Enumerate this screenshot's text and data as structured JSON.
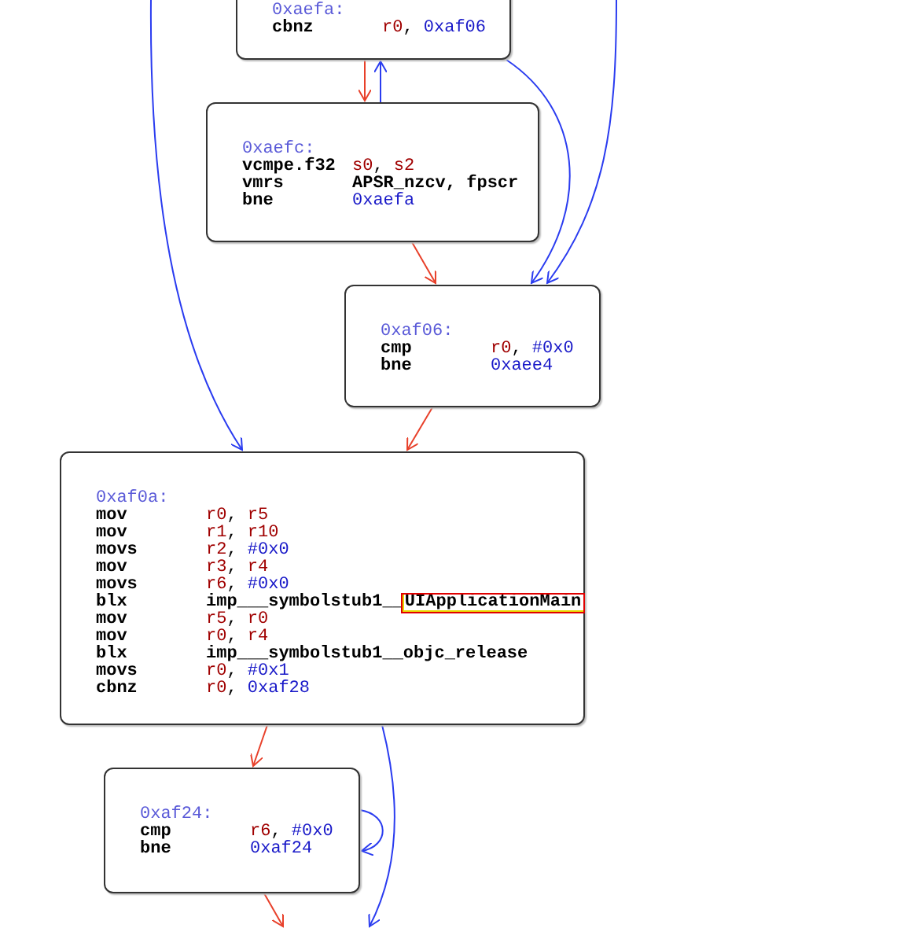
{
  "nodes": [
    {
      "label": "0xaefa:",
      "lines": [
        {
          "mnemonic": "cbnz",
          "operands": [
            {
              "text": "r0",
              "kind": "reg"
            },
            {
              "text": ", ",
              "kind": "sep"
            },
            {
              "text": "0xaf06",
              "kind": "addr"
            }
          ]
        }
      ]
    },
    {
      "label": "0xaefc:",
      "lines": [
        {
          "mnemonic": "vcmpe.f32",
          "operands": [
            {
              "text": "s0",
              "kind": "reg"
            },
            {
              "text": ", ",
              "kind": "sep"
            },
            {
              "text": "s2",
              "kind": "reg"
            }
          ]
        },
        {
          "mnemonic": "vmrs",
          "operands": [
            {
              "text": "APSR_nzcv, fpscr",
              "kind": "sym"
            }
          ]
        },
        {
          "mnemonic": "bne",
          "operands": [
            {
              "text": "0xaefa",
              "kind": "addr"
            }
          ]
        }
      ]
    },
    {
      "label": "0xaf06:",
      "lines": [
        {
          "mnemonic": "cmp",
          "operands": [
            {
              "text": "r0",
              "kind": "reg"
            },
            {
              "text": ", ",
              "kind": "sep"
            },
            {
              "text": "#0x0",
              "kind": "imm"
            }
          ]
        },
        {
          "mnemonic": "bne",
          "operands": [
            {
              "text": "0xaee4",
              "kind": "addr"
            }
          ]
        }
      ]
    },
    {
      "label": "0xaf0a:",
      "lines": [
        {
          "mnemonic": "mov",
          "operands": [
            {
              "text": "r0",
              "kind": "reg"
            },
            {
              "text": ", ",
              "kind": "sep"
            },
            {
              "text": "r5",
              "kind": "reg"
            }
          ]
        },
        {
          "mnemonic": "mov",
          "operands": [
            {
              "text": "r1",
              "kind": "reg"
            },
            {
              "text": ", ",
              "kind": "sep"
            },
            {
              "text": "r10",
              "kind": "reg"
            }
          ]
        },
        {
          "mnemonic": "movs",
          "operands": [
            {
              "text": "r2",
              "kind": "reg"
            },
            {
              "text": ", ",
              "kind": "sep"
            },
            {
              "text": "#0x0",
              "kind": "imm"
            }
          ]
        },
        {
          "mnemonic": "mov",
          "operands": [
            {
              "text": "r3",
              "kind": "reg"
            },
            {
              "text": ", ",
              "kind": "sep"
            },
            {
              "text": "r4",
              "kind": "reg"
            }
          ]
        },
        {
          "mnemonic": "movs",
          "operands": [
            {
              "text": "r6",
              "kind": "reg"
            },
            {
              "text": ", ",
              "kind": "sep"
            },
            {
              "text": "#0x0",
              "kind": "imm"
            }
          ]
        },
        {
          "mnemonic": "blx",
          "operands": [
            {
              "text": "imp___symbolstub1__",
              "kind": "sym"
            },
            {
              "text": "UIApplicationMain",
              "kind": "highlight"
            }
          ]
        },
        {
          "mnemonic": "mov",
          "operands": [
            {
              "text": "r5",
              "kind": "reg"
            },
            {
              "text": ", ",
              "kind": "sep"
            },
            {
              "text": "r0",
              "kind": "reg"
            }
          ]
        },
        {
          "mnemonic": "mov",
          "operands": [
            {
              "text": "r0",
              "kind": "reg"
            },
            {
              "text": ", ",
              "kind": "sep"
            },
            {
              "text": "r4",
              "kind": "reg"
            }
          ]
        },
        {
          "mnemonic": "blx",
          "operands": [
            {
              "text": "imp___symbolstub1__objc_release",
              "kind": "sym"
            }
          ]
        },
        {
          "mnemonic": "movs",
          "operands": [
            {
              "text": "r0",
              "kind": "reg"
            },
            {
              "text": ", ",
              "kind": "sep"
            },
            {
              "text": "#0x1",
              "kind": "imm"
            }
          ]
        },
        {
          "mnemonic": "cbnz",
          "operands": [
            {
              "text": "r0",
              "kind": "reg"
            },
            {
              "text": ", ",
              "kind": "sep"
            },
            {
              "text": "0xaf28",
              "kind": "addr"
            }
          ]
        }
      ]
    },
    {
      "label": "0xaf24:",
      "lines": [
        {
          "mnemonic": "cmp",
          "operands": [
            {
              "text": "r6",
              "kind": "reg"
            },
            {
              "text": ", ",
              "kind": "sep"
            },
            {
              "text": "#0x0",
              "kind": "imm"
            }
          ]
        },
        {
          "mnemonic": "bne",
          "operands": [
            {
              "text": "0xaf24",
              "kind": "addr"
            }
          ]
        }
      ]
    }
  ]
}
